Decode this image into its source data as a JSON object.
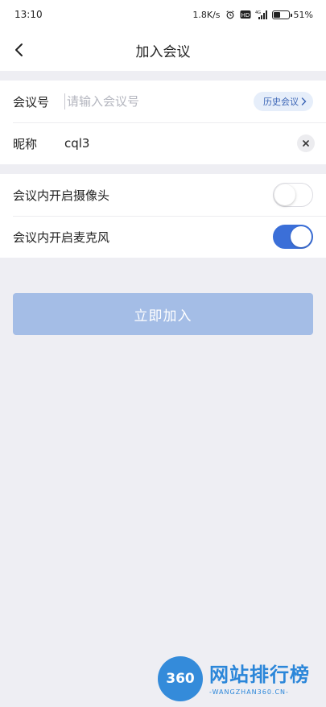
{
  "status_bar": {
    "time": "13:10",
    "network_speed": "1.8K/s",
    "battery_percent": "51%",
    "battery_level": 0.51,
    "icons": [
      "alarm-icon",
      "hd-icon",
      "signal-4g-icon",
      "battery-icon"
    ]
  },
  "navbar": {
    "back_icon": "chevron-left-icon",
    "title": "加入会议"
  },
  "form": {
    "meeting_id": {
      "label": "会议号",
      "value": "",
      "placeholder": "请输入会议号",
      "history_label": "历史会议"
    },
    "nickname": {
      "label": "昵称",
      "value": "cql3"
    }
  },
  "settings": {
    "camera": {
      "label": "会议内开启摄像头",
      "enabled": false
    },
    "microphone": {
      "label": "会议内开启麦克风",
      "enabled": true
    }
  },
  "join_button": {
    "label": "立即加入"
  },
  "watermark": {
    "logo_text": "360",
    "title": "网站排行榜",
    "subtitle": "-WANGZHAN360.CN-"
  },
  "colors": {
    "accent": "#3b6fd8",
    "join_button_disabled": "#a4bde6",
    "page_background": "#eeeef3"
  }
}
